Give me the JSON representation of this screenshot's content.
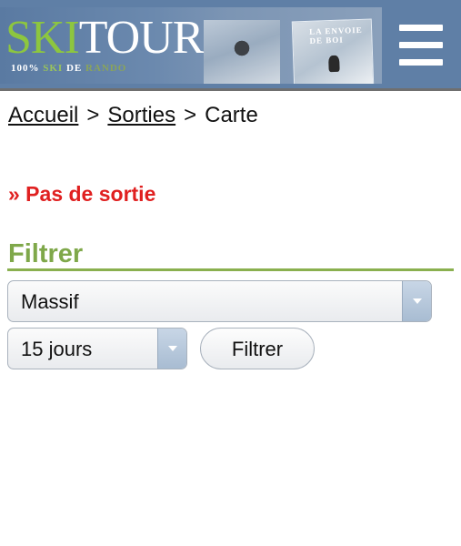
{
  "header": {
    "logo": {
      "ski": "SKI",
      "tour": "TOUR"
    },
    "tagline": {
      "a": "100% ",
      "b": "SKI",
      "c": " DE ",
      "d": "RANDO"
    },
    "photo_caption": "LA ENVOIE DE BOI",
    "menu_icon": "hamburger-menu-icon"
  },
  "breadcrumb": {
    "items": [
      "Accueil",
      "Sorties",
      "Carte"
    ],
    "separator": ">"
  },
  "message": {
    "no_outing": "» Pas de sortie"
  },
  "filter": {
    "title": "Filtrer",
    "massif_select": {
      "value": "Massif"
    },
    "days_select": {
      "value": "15 jours"
    },
    "submit_label": "Filtrer"
  },
  "colors": {
    "banner": "#5f7fa6",
    "logo_ski": "#8dc63f",
    "alert": "#e02020",
    "filter_title": "#7fa84a"
  }
}
